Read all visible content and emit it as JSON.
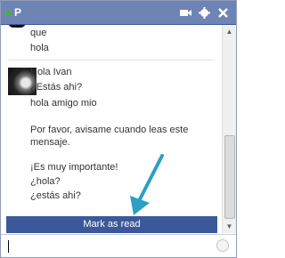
{
  "chat": {
    "contact_name": "P",
    "status_color": "#42b72a",
    "header_bg": "#6d84b4",
    "icons": [
      "video-icon",
      "gear-icon",
      "close-icon",
      "status-dot"
    ]
  },
  "messages": {
    "group_prev": [
      "que",
      "hola"
    ],
    "group_current": [
      "Hola Ivan",
      "¿Estás ahi?",
      "hola amigo mio",
      "Por favor, avisame cuando leas este",
      "mensaje.",
      "¡Es muy importante!",
      "¿hola?",
      "¿estás ahi?"
    ]
  },
  "actions": {
    "mark_as_read_label": "Mark as read",
    "button_color": "#3b5998"
  },
  "input": {
    "value": ""
  }
}
